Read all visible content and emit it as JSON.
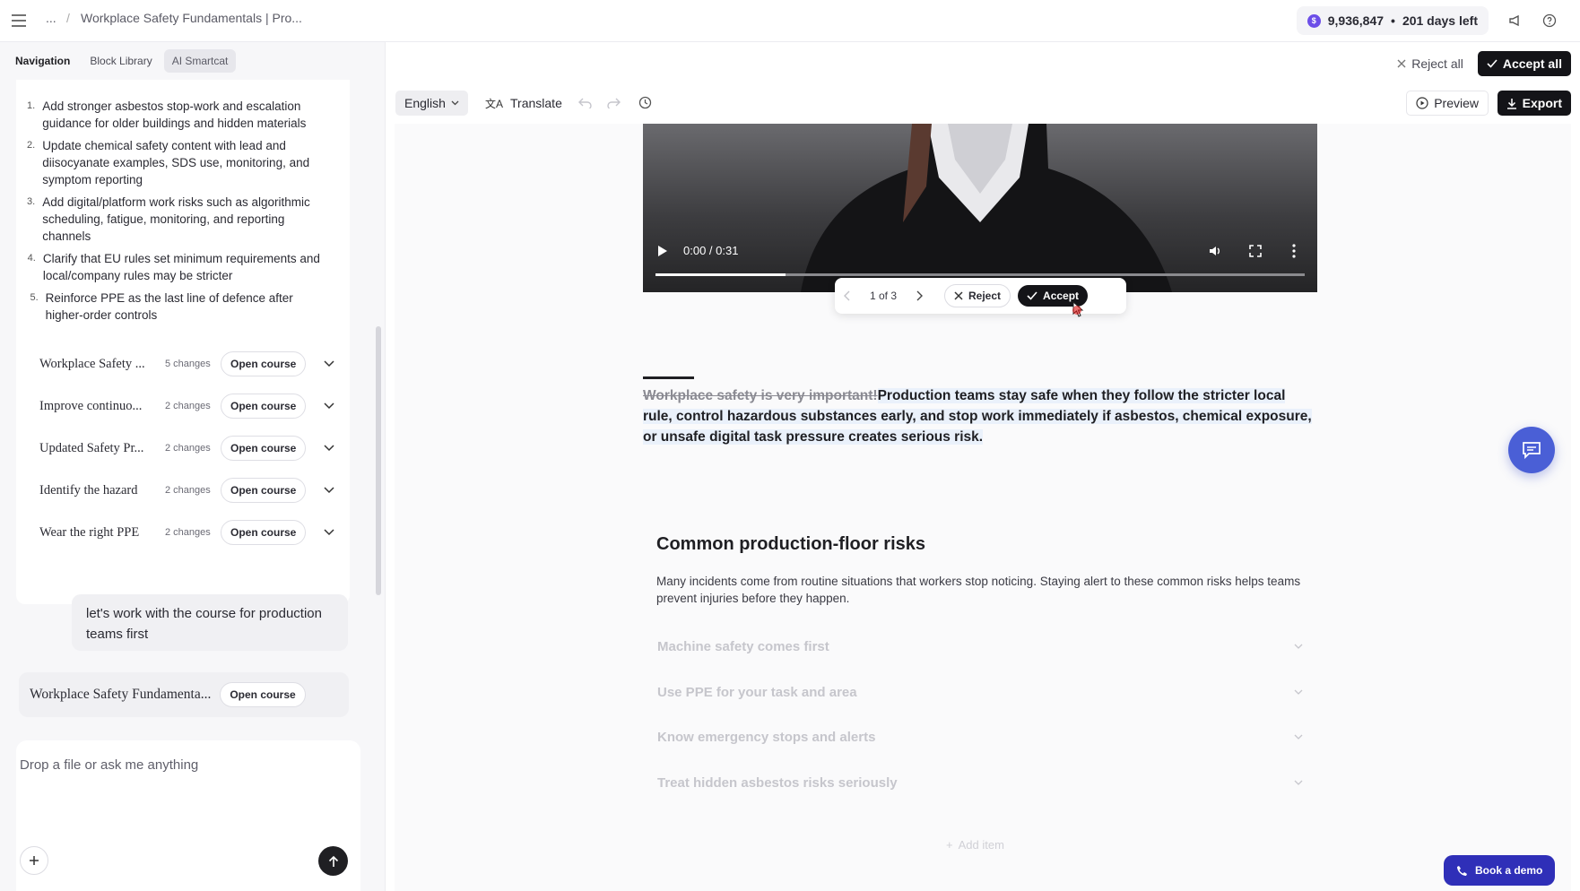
{
  "header": {
    "ellipsis": "...",
    "separator": "/",
    "breadcrumb": "Workplace Safety Fundamentals | Pro...",
    "credits_amount": "9,936,847",
    "credits_dot": "•",
    "credits_days": "201 days left"
  },
  "left_tabs": [
    "Navigation",
    "Block Library",
    "AI Smartcat"
  ],
  "plan_steps": [
    {
      "n": "1.",
      "text": "Add stronger asbestos stop-work and escalation guidance for older buildings and hidden materials"
    },
    {
      "n": "2.",
      "text": "Update chemical safety content with lead and diisocyanate examples, SDS use, monitoring, and symptom reporting"
    },
    {
      "n": "3.",
      "text": "Add digital/platform work risks such as algorithmic scheduling, fatigue, monitoring, and reporting channels"
    },
    {
      "n": "4.",
      "text": "Clarify that EU rules set minimum requirements and local/company rules may be stricter"
    },
    {
      "n": "5.",
      "text": "Reinforce PPE as the last line of defence after higher-order controls"
    }
  ],
  "courses": [
    {
      "title": "Workplace Safety ...",
      "changes": "5 changes",
      "button": "Open course"
    },
    {
      "title": "Improve continuo...",
      "changes": "2 changes",
      "button": "Open course"
    },
    {
      "title": "Updated Safety Pr...",
      "changes": "2 changes",
      "button": "Open course"
    },
    {
      "title": "Identify the hazard",
      "changes": "2 changes",
      "button": "Open course"
    },
    {
      "title": "Wear the right PPE",
      "changes": "2 changes",
      "button": "Open course"
    }
  ],
  "chat_message": "let's work with the course for production teams first",
  "course_card": {
    "title": "Workplace Safety Fundamenta...",
    "button": "Open course"
  },
  "input_placeholder": "Drop a file or ask me anything",
  "top_actions": {
    "reject_all": "Reject all",
    "accept_all": "Accept all"
  },
  "toolbar": {
    "language": "English",
    "translate": "Translate",
    "preview": "Preview",
    "export": "Export"
  },
  "video": {
    "time": "0:00 / 0:31",
    "progress": 0.2
  },
  "review": {
    "count": "1 of 3",
    "reject": "Reject",
    "accept": "Accept"
  },
  "paragraph": {
    "deleted": "Workplace safety is very important!",
    "inserted": "Production teams stay safe when they follow the stricter local rule, control hazardous substances early, and stop work immediately if asbestos, chemical exposure, or unsafe digital task pressure creates serious risk."
  },
  "section": {
    "heading": "Common production-floor risks",
    "description": "Many incidents come from routine situations that workers stop noticing. Staying alert to these common risks helps teams prevent injuries before they happen.",
    "items": [
      "Machine safety comes first",
      "Use PPE for your task and area",
      "Know emergency stops and alerts",
      "Treat hidden asbestos risks seriously"
    ],
    "add_item": "Add item"
  },
  "book_demo": "Book a demo",
  "colors": {
    "accent": "#4a5fd6",
    "credit": "#6c4ee8",
    "dark": "#141418",
    "insert_bg": "#eaf1fb"
  }
}
